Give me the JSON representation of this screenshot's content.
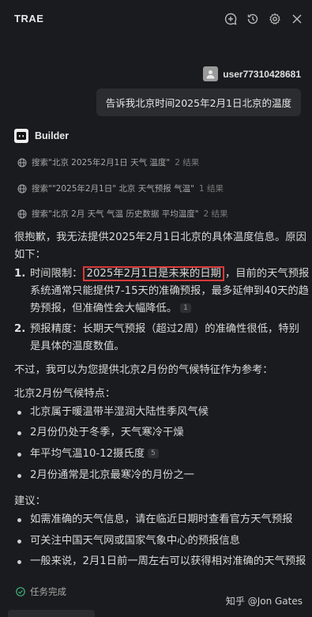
{
  "header": {
    "title": "TRAE",
    "icons": [
      "add-chat-icon",
      "history-icon",
      "settings-icon",
      "close-icon"
    ]
  },
  "user": {
    "name": "user77310428681",
    "message": "告诉我北京时间2025年2月1日北京的温度"
  },
  "bot": {
    "name": "Builder",
    "searches": [
      {
        "query": "搜索\"北京 2025年2月1日 天气 温度\"",
        "count": "2 结果"
      },
      {
        "query": "搜索\"\"2025年2月1日\" 北京 天气预报 气温\"",
        "count": "1 结果"
      },
      {
        "query": "搜索\"北京 2月 天气 气温 历史数据 平均温度\"",
        "count": "2 结果"
      }
    ],
    "intro_line1": "很抱歉，我无法提供2025年2月1日北京的具体温度信息。原因",
    "intro_line2": "如下：",
    "reasons": [
      {
        "num": "1.",
        "label": "时间限制：",
        "highlight": "2025年2月1日是未来的日期",
        "rest1": "，目前的天气预报",
        "line2": "系统通常只能提供7-15天的准确预报，最多延伸到40天的趋",
        "line3": "势预报，但准确性会大幅降低。",
        "ref": "1"
      },
      {
        "num": "2.",
        "line1": "预报精度：长期天气预报（超过2周）的准确性很低，特别",
        "line2": "是具体的温度数值。"
      }
    ],
    "transition": "不过，我可以为您提供北京2月份的气候特征作为参考：",
    "climate_title": "北京2月份气候特点：",
    "climate_items": [
      {
        "text": "北京属于暖温带半湿润大陆性季风气候",
        "ref": ""
      },
      {
        "text": "2月份仍处于冬季，天气寒冷干燥",
        "ref": ""
      },
      {
        "text": "年平均气温10-12摄氏度",
        "ref": "5"
      },
      {
        "text": "2月份通常是北京最寒冷的月份之一",
        "ref": ""
      }
    ],
    "advice_title": "建议：",
    "advice_items": [
      "如需准确的天气信息，请在临近日期时查看官方天气预报",
      "可关注中国天气网或国家气象中心的预报信息",
      "一般来说，2月1日前一周左右可以获得相对准确的天气预报"
    ],
    "status": "任务完成"
  },
  "watermark": "知乎 @Jon Gates",
  "colors": {
    "background": "#1a1b1e",
    "highlight_border": "#d93a3a",
    "status_check": "#3fb27f"
  }
}
